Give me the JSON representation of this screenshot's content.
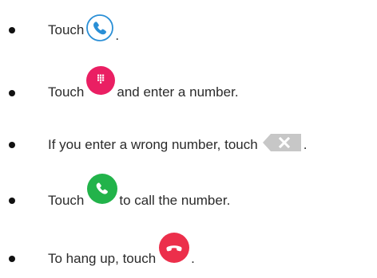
{
  "steps": [
    {
      "before": "Touch",
      "icon": "phone-app-icon",
      "after": ".",
      "icon_color": "#2a8fd6"
    },
    {
      "before": "Touch",
      "icon": "dialpad-icon",
      "after": "and enter a number.",
      "icon_color": "#ea1f63"
    },
    {
      "before": "If you enter a wrong number, touch",
      "icon": "backspace-icon",
      "after": ".",
      "icon_color": "#c7c7c7"
    },
    {
      "before": "Touch",
      "icon": "call-icon",
      "after": "to call the number.",
      "icon_color": "#22b34a"
    },
    {
      "before": "To hang up, touch",
      "icon": "end-call-icon",
      "after": ".",
      "icon_color": "#ec2f4b"
    }
  ]
}
